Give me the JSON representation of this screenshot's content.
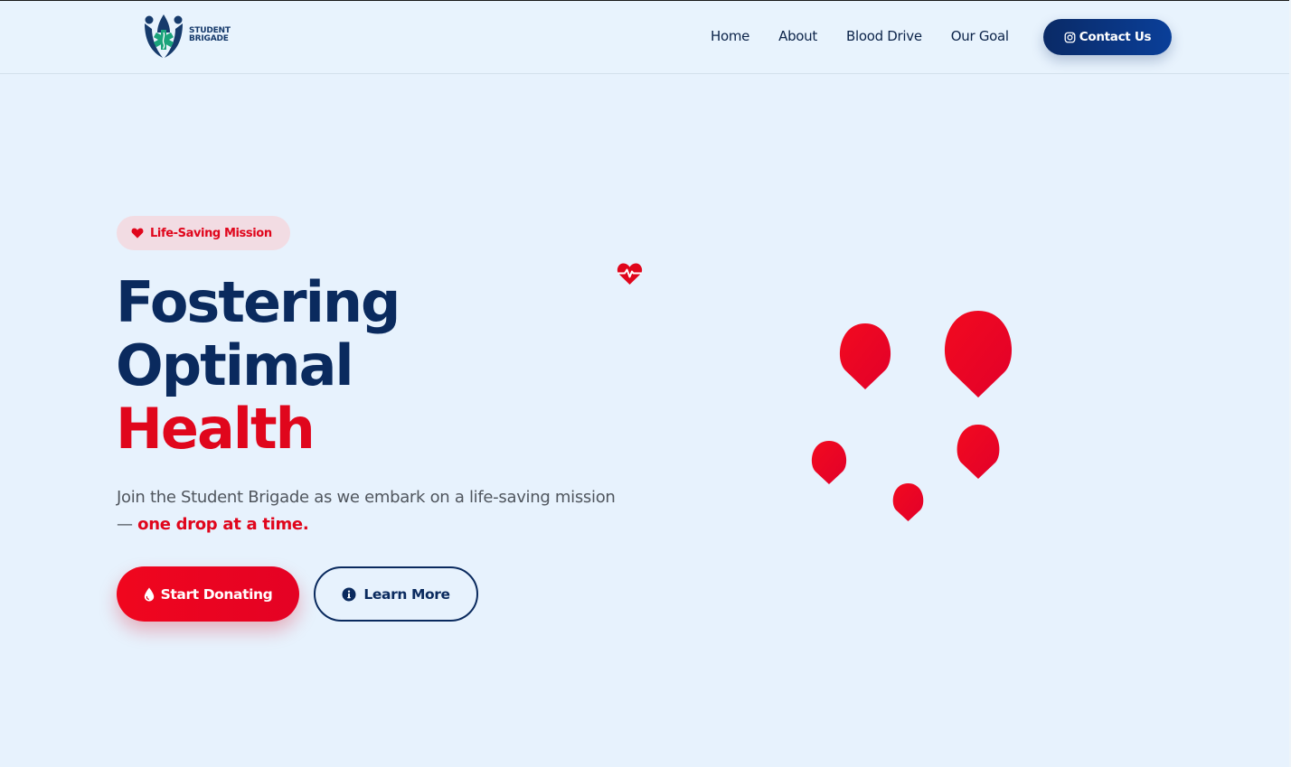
{
  "brand": {
    "logo_line1": "STUDENT",
    "logo_line2": "BRIGADE",
    "accent_red": "#e0061c",
    "navy": "#0a2a5e",
    "logo_green": "#1aa37a"
  },
  "nav": {
    "items": [
      "Home",
      "About",
      "Blood Drive",
      "Our Goal"
    ],
    "contact_label": "Contact Us",
    "contact_icon": "instagram-icon"
  },
  "hero": {
    "badge": {
      "icon": "heart-icon",
      "label": "Life-Saving Mission"
    },
    "headline": {
      "line1": "Fostering",
      "line2": "Optimal",
      "line3": "Health"
    },
    "subtitle": {
      "text": "Join the Student Brigade as we embark on a life-saving mission — ",
      "highlight": "one drop at a time."
    },
    "primary_button": {
      "icon": "blood-drop-icon",
      "label": "Start Donating"
    },
    "secondary_button": {
      "icon": "info-circle-icon",
      "label": "Learn More"
    }
  },
  "decor": {
    "heartbeat_icon": "heart-pulse-icon",
    "drops": "blood-drop-icon"
  }
}
